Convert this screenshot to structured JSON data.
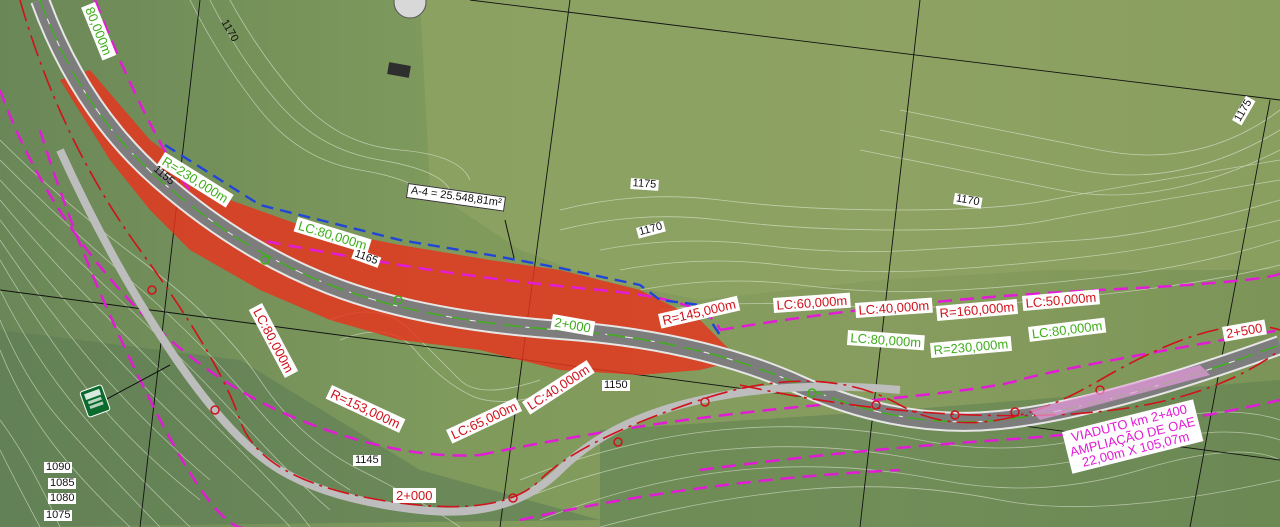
{
  "map": {
    "radii": [
      {
        "text": "R=230,000m",
        "color": "green"
      },
      {
        "text": "R=145,000m",
        "color": "red"
      },
      {
        "text": "R=160,000m",
        "color": "red"
      },
      {
        "text": "R=230,000m",
        "color": "green"
      },
      {
        "text": "R=153,000m",
        "color": "red"
      }
    ],
    "clothoids": [
      {
        "text": "80,000m",
        "color": "green"
      },
      {
        "text": "LC:80,000m",
        "color": "green"
      },
      {
        "text": "LC:60,000m",
        "color": "red"
      },
      {
        "text": "LC:40,000m",
        "color": "red"
      },
      {
        "text": "LC:50,000m",
        "color": "red"
      },
      {
        "text": "LC:80,000m",
        "color": "green"
      },
      {
        "text": "LC:80,000m",
        "color": "green"
      },
      {
        "text": "LC:80,000m",
        "color": "red"
      },
      {
        "text": "LC:65,000m",
        "color": "red"
      },
      {
        "text": "LC:40,000m",
        "color": "red"
      }
    ],
    "stations": [
      "2+000",
      "2+500",
      "2+000"
    ],
    "area_label": "A-4 = 25.548,81m²",
    "elevations": [
      "1170",
      "1175",
      "1175",
      "1170",
      "1170",
      "1155",
      "1165",
      "1150",
      "1145",
      "1090",
      "1085",
      "1080",
      "1075"
    ],
    "viaduct": {
      "line1": "VIADUTO km 2+400",
      "line2": "AMPLIAÇÃO DE OAE",
      "line3": "22,00m X 105,07m"
    },
    "colors": {
      "road": "#8c8c8c",
      "cut_area": "#e8331d",
      "magenta_offset": "#e21bd6",
      "axis_green": "#3fae1b",
      "red_alignment": "#d0121b",
      "area_boundary": "#2046d8"
    }
  }
}
